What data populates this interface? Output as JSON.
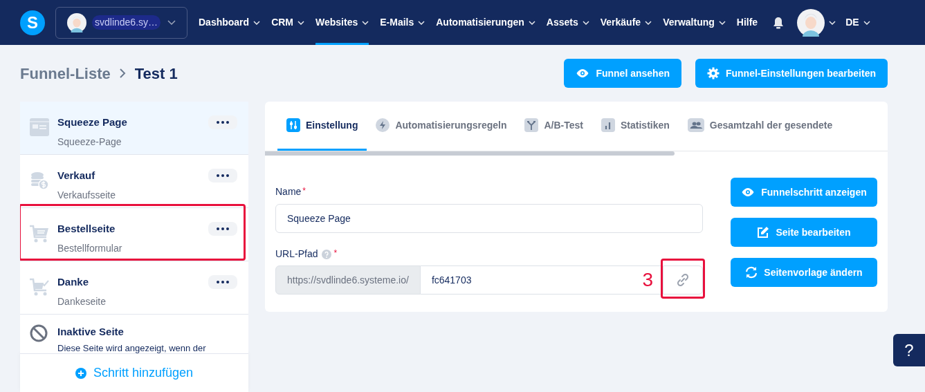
{
  "nav": {
    "logo": "S",
    "account": "svdlinde6.sy…",
    "items": [
      {
        "label": "Dashboard",
        "dropdown": true,
        "selected": false
      },
      {
        "label": "CRM",
        "dropdown": true,
        "selected": false
      },
      {
        "label": "Websites",
        "dropdown": true,
        "selected": true
      },
      {
        "label": "E-Mails",
        "dropdown": true,
        "selected": false
      },
      {
        "label": "Automatisierungen",
        "dropdown": true,
        "selected": false
      },
      {
        "label": "Assets",
        "dropdown": true,
        "selected": false
      },
      {
        "label": "Verkäufe",
        "dropdown": true,
        "selected": false
      },
      {
        "label": "Verwaltung",
        "dropdown": true,
        "selected": false
      },
      {
        "label": "Hilfe",
        "dropdown": false,
        "selected": false
      }
    ],
    "language": "DE"
  },
  "breadcrumb": {
    "parent": "Funnel-Liste",
    "current": "Test 1"
  },
  "header_buttons": [
    {
      "label": "Funnel ansehen"
    },
    {
      "label": "Funnel-Einstellungen bearbeiten"
    }
  ],
  "steps": [
    {
      "kind": "form",
      "title": "Squeeze Page",
      "subtitle": "Squeeze-Page",
      "selected": true,
      "annotated": false
    },
    {
      "kind": "sales",
      "title": "Verkauf",
      "subtitle": "Verkaufsseite",
      "selected": false,
      "annotated": false
    },
    {
      "kind": "order",
      "title": "Bestellseite",
      "subtitle": "Bestellformular",
      "selected": false,
      "annotated": true
    },
    {
      "kind": "thanks",
      "title": "Danke",
      "subtitle": "Dankeseite",
      "selected": false,
      "annotated": false
    },
    {
      "kind": "inactive",
      "title": "Inaktive Seite",
      "subtitle": "Diese Seite wird angezeigt, wenn der",
      "selected": false,
      "annotated": false
    }
  ],
  "add_step": "Schritt hinzufügen",
  "tabs": [
    {
      "label": "Einstellung",
      "selected": true
    },
    {
      "label": "Automatisierungsregeln",
      "selected": false
    },
    {
      "label": "A/B-Test",
      "selected": false
    },
    {
      "label": "Statistiken",
      "selected": false
    },
    {
      "label": "Gesamtzahl der gesendete",
      "selected": false
    }
  ],
  "form": {
    "name_label": "Name",
    "name_required": "*",
    "name_value": "Squeeze Page",
    "url_label": "URL-Pfad",
    "url_required": "*",
    "url_prefix": "https://svdlinde6.systeme.io/",
    "url_value": "fc641703",
    "link_annotated": true,
    "annotation_label": "3"
  },
  "side_buttons": [
    {
      "label": "Funnelschritt anzeigen"
    },
    {
      "label": "Seite bearbeiten"
    },
    {
      "label": "Seitenvorlage ändern"
    }
  ],
  "help_button": "?"
}
